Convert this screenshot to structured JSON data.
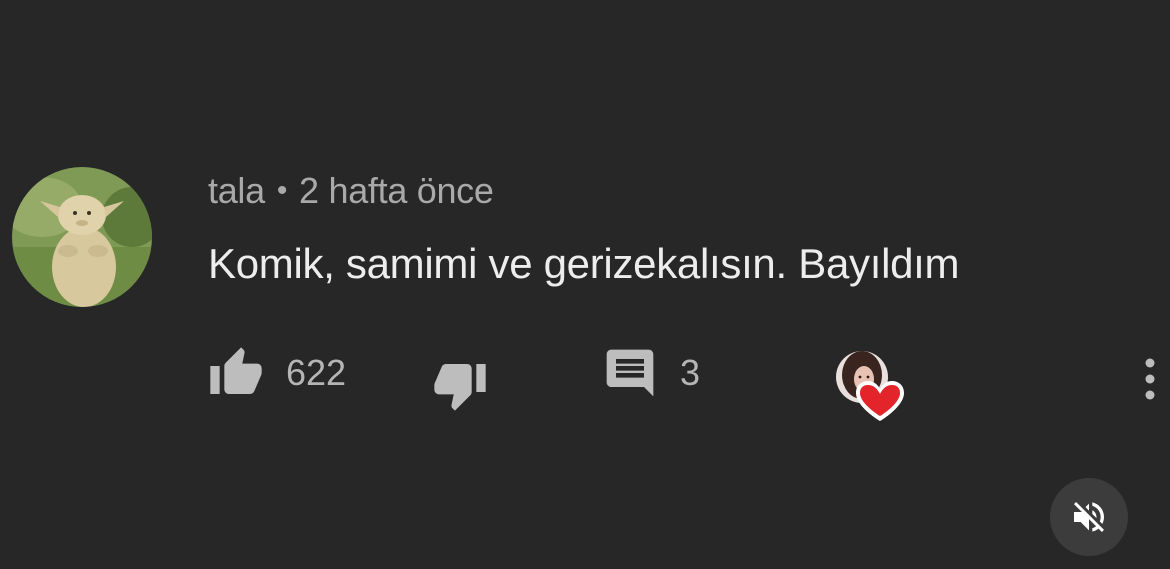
{
  "comment": {
    "author": "tala",
    "separator": "•",
    "time": "2 hafta önce",
    "text": "Komik, samimi ve gerizekalısın. Bayıldım",
    "likes": "622",
    "replies": "3"
  },
  "icons": {
    "avatar": "creature-avatar",
    "like": "thumbs-up-icon",
    "dislike": "thumbs-down-icon",
    "reply": "comment-icon",
    "hearted": "creator-heart-icon",
    "more": "more-vertical-icon",
    "mute": "muted-speaker-icon"
  },
  "colors": {
    "background": "#272727",
    "heart": "#e3242b"
  }
}
